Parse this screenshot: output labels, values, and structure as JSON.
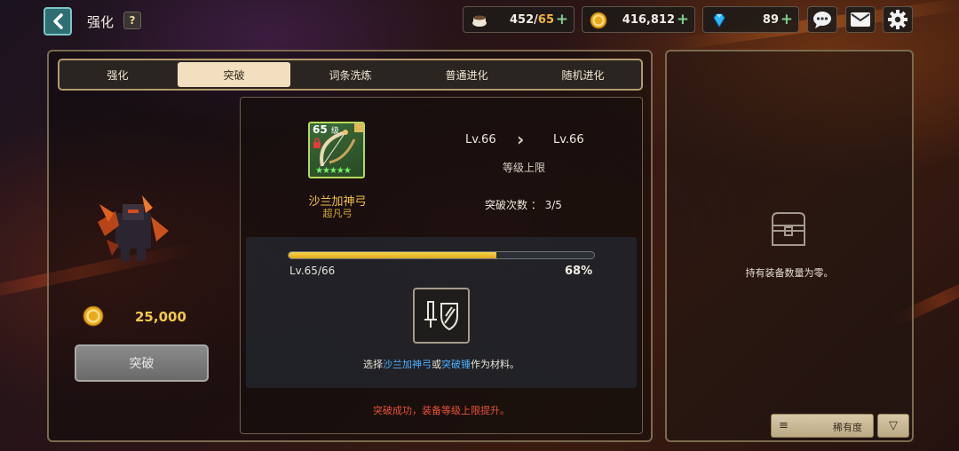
{
  "header": {
    "title": "强化",
    "help_label": "?",
    "back_icon": "chevron-left-icon"
  },
  "resources": {
    "stamina": {
      "icon": "coffee-cup-icon",
      "current": "452",
      "separator": "/",
      "max": "65",
      "plus": "+"
    },
    "gold": {
      "icon": "gold-coin-icon",
      "value": "416,812",
      "plus": "+"
    },
    "gems": {
      "icon": "diamond-icon",
      "value": "89",
      "plus": "+"
    }
  },
  "top_buttons": [
    "chat-icon",
    "mail-icon",
    "gear-icon"
  ],
  "tabs": [
    {
      "label": "强化",
      "active": false
    },
    {
      "label": "突破",
      "active": true
    },
    {
      "label": "词条洗炼",
      "active": false
    },
    {
      "label": "普通进化",
      "active": false
    },
    {
      "label": "随机进化",
      "active": false
    }
  ],
  "cost": {
    "icon": "gold-coin-icon",
    "value": "25,000"
  },
  "break_button": {
    "label": "突破"
  },
  "item": {
    "level": "65",
    "level_unit": "级",
    "stars": "★★★★★",
    "star_count": 5,
    "name": "沙兰加神弓",
    "grade": "超凡弓"
  },
  "level_info": {
    "from": "Lv.66",
    "to": "Lv.66",
    "cap_label": "等级上限",
    "break_count_label": "突破次数 ： 3/5"
  },
  "progress": {
    "level_text": "Lv.65/66",
    "percent_text": "68%",
    "fraction": 0.68
  },
  "material": {
    "hint_prefix": "选择",
    "hint_item": "沙兰加神弓",
    "hint_or": "或",
    "hint_hammer": "突破锤",
    "hint_suffix": "作为材料。"
  },
  "success_note": "突破成功，装备等级上限提升。",
  "inventory": {
    "empty_text": "持有装备数量为零。",
    "sort_label": "稀有度",
    "sort_lines": "≡",
    "sort_dir": "▽"
  },
  "colors": {
    "accent_gold": "#f3c94c",
    "progress_fill": "#f2c033",
    "highlight_blue": "#4fb0ff",
    "warning_red": "#e9533a",
    "active_tab": "#f1dfbf"
  }
}
